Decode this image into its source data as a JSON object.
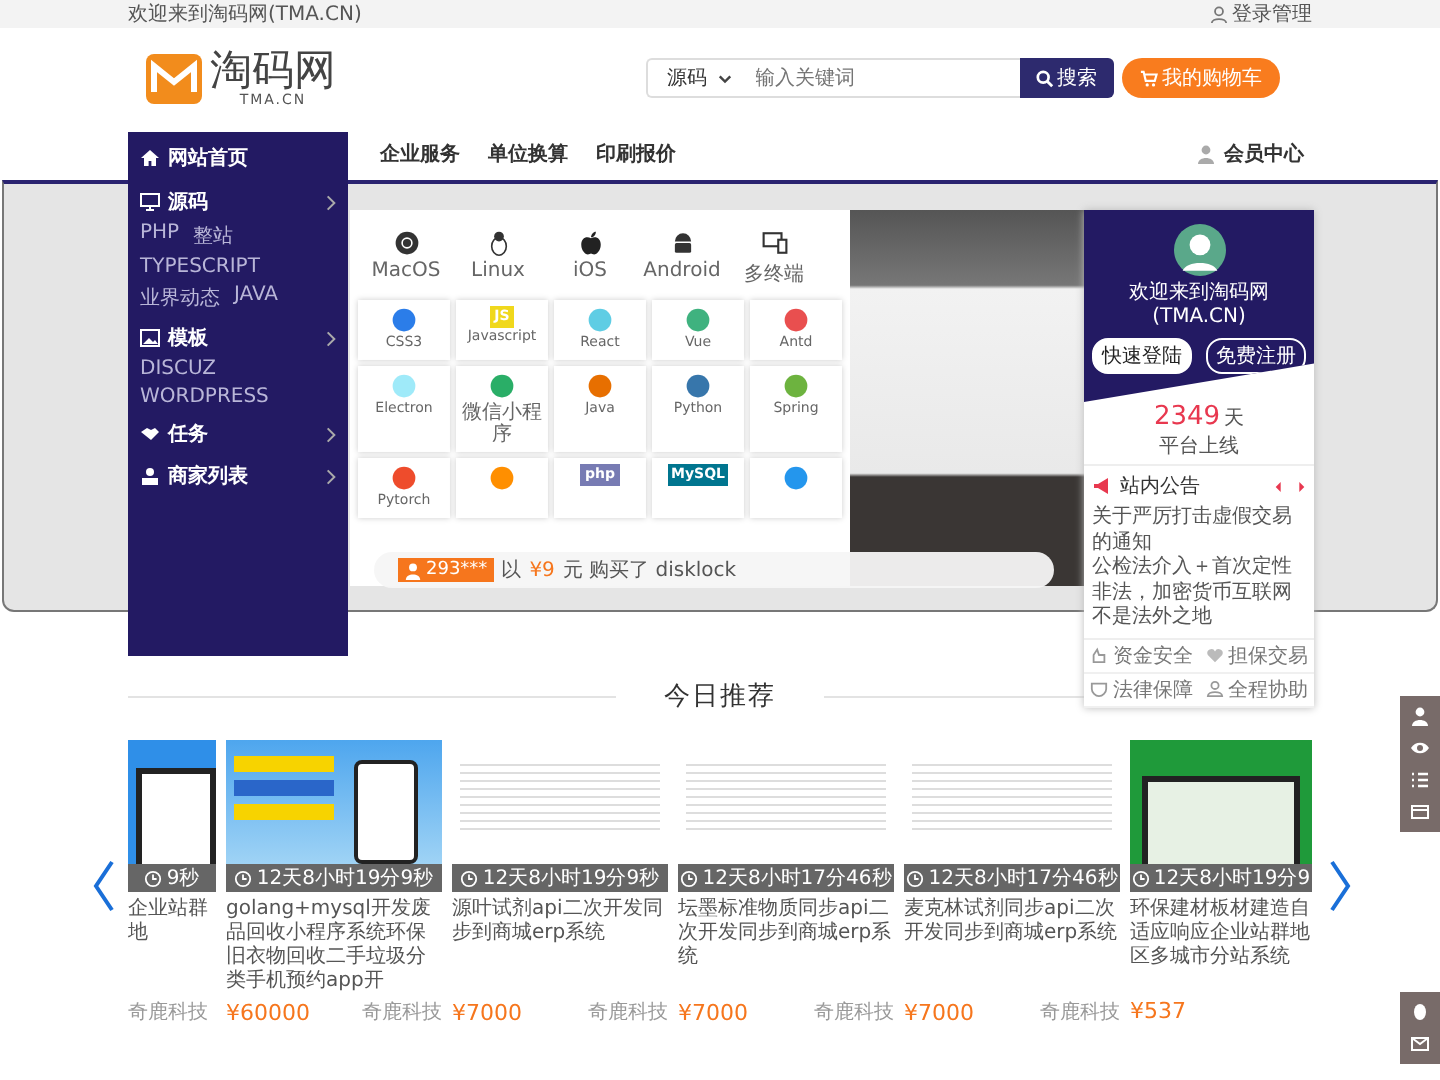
{
  "top_bar": {
    "welcome": "欢迎来到淘码网(TMA.CN)",
    "login": "登录管理"
  },
  "logo": {
    "name": "淘码网",
    "domain": "TMA.CN"
  },
  "search": {
    "category": "源码",
    "placeholder": "输入关键词",
    "button": "搜索"
  },
  "cart": {
    "label": "我的购物车"
  },
  "nav": {
    "items": [
      "企业服务",
      "单位换算",
      "印刷报价"
    ],
    "member": "会员中心"
  },
  "menu": {
    "home": "网站首页",
    "categories": [
      {
        "name": "源码",
        "kind": "monitor",
        "tags": [
          "PHP",
          "整站",
          "TYPESCRIPT",
          "业界动态",
          "JAVA"
        ]
      },
      {
        "name": "模板",
        "kind": "image",
        "tags": [
          "DISCUZ",
          "WORDPRESS"
        ]
      },
      {
        "name": "任务",
        "kind": "handshake"
      },
      {
        "name": "商家列表",
        "kind": "user"
      }
    ]
  },
  "platforms": [
    {
      "label": "MacOS",
      "kind": "macos"
    },
    {
      "label": "Linux",
      "kind": "linux"
    },
    {
      "label": "iOS",
      "kind": "ios"
    },
    {
      "label": "Android",
      "kind": "android"
    },
    {
      "label": "多终端",
      "kind": "devices"
    }
  ],
  "tech": [
    {
      "label": "CSS3",
      "color": "#2b7de9"
    },
    {
      "label": "Javascript",
      "color": "#f0d81c",
      "logo": "JS"
    },
    {
      "label": "React",
      "color": "#5fcde4"
    },
    {
      "label": "Vue",
      "color": "#3fb27f"
    },
    {
      "label": "Antd",
      "color": "#e94f4f"
    },
    {
      "label": "Electron",
      "color": "#9feaf9"
    },
    {
      "label": "微信小程序",
      "color": "#2aae67"
    },
    {
      "label": "Java",
      "color": "#e76f00"
    },
    {
      "label": "Python",
      "color": "#3776ab"
    },
    {
      "label": "Spring",
      "color": "#6db33f"
    },
    {
      "label": "Pytorch",
      "color": "#ee4c2c"
    },
    {
      "color": "#ff8f00"
    },
    {
      "color": "#777bb3",
      "logo": "php"
    },
    {
      "color": "#00758f",
      "logo": "MySQL"
    },
    {
      "color": "#2496ed"
    }
  ],
  "ticker": {
    "user": "293***",
    "prefix": "以",
    "amount": "¥9",
    "suffix": "元 购买了 disklock"
  },
  "user_panel": {
    "welcome": "欢迎来到淘码网(TMA.CN)",
    "login": "快速登陆",
    "register": "免费注册",
    "days": "2349",
    "days_unit": "天",
    "days_label": "平台上线",
    "notice_title": "站内公告",
    "notices": [
      "关于严厉打击虚假交易的通知",
      "公检法介入＋首次定性非法，加密货币互联网不是法外之地"
    ],
    "features": [
      {
        "label": "资金安全",
        "kind": "safe"
      },
      {
        "label": "担保交易",
        "kind": "heart"
      },
      {
        "label": "法律保障",
        "kind": "shield"
      },
      {
        "label": "全程协助",
        "kind": "user"
      }
    ]
  },
  "section_title": "今日推荐",
  "products": [
    {
      "kind": "site",
      "timer": "9秒",
      "title": "企业站群地",
      "seller": "奇鹿科技",
      "partial": true
    },
    {
      "kind": "poster",
      "timer": "12天8小时19分9秒",
      "title": "golang+mysql开发废品回收小程序系统环保旧衣物回收二手垃圾分类手机预约app开",
      "seller": "奇鹿科技",
      "price": "¥60000"
    },
    {
      "kind": "table",
      "timer": "12天8小时19分9秒",
      "title": "源叶试剂api二次开发同步到商城erp系统",
      "seller": "奇鹿科技",
      "price": "¥7000"
    },
    {
      "kind": "table",
      "timer": "12天8小时17分46秒",
      "title": "坛墨标准物质同步api二次开发同步到商城erp系统",
      "seller": "奇鹿科技",
      "price": "¥7000"
    },
    {
      "kind": "table",
      "timer": "12天8小时17分46秒",
      "title": "麦克林试剂同步api二次开发同步到商城erp系统",
      "seller": "奇鹿科技",
      "price": "¥7000"
    },
    {
      "kind": "green",
      "timer": "12天8小时19分9",
      "title": "环保建材板材建造自适应响应企业站群地区多城市分站系统",
      "price": "¥537",
      "partial": true
    }
  ]
}
